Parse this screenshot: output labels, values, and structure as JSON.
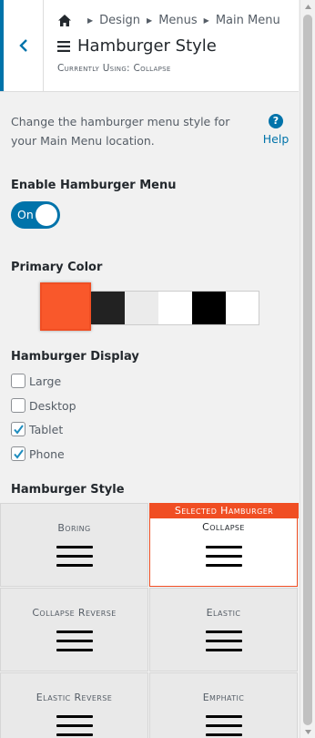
{
  "header": {
    "breadcrumbs": [
      "Design",
      "Menus",
      "Main Menu"
    ],
    "title": "Hamburger Style",
    "currently_using": "Currently Using: Collapse"
  },
  "description": "Change the hamburger menu style for your Main Menu location.",
  "help_label": "Help",
  "enable_label": "Enable Hamburger Menu",
  "toggle": {
    "state_text": "On"
  },
  "primary_color_label": "Primary Color",
  "swatches": [
    {
      "color": "#f9582b",
      "selected": true
    },
    {
      "color": "#222222"
    },
    {
      "color": "#ebebeb"
    },
    {
      "color": "#ffffff"
    },
    {
      "color": "#000000"
    },
    {
      "color": "#ffffff"
    }
  ],
  "display_label": "Hamburger Display",
  "display_options": [
    {
      "label": "Large",
      "checked": false
    },
    {
      "label": "Desktop",
      "checked": false
    },
    {
      "label": "Tablet",
      "checked": true
    },
    {
      "label": "Phone",
      "checked": true
    }
  ],
  "style_label": "Hamburger Style",
  "selected_banner": "Selected Hamburger",
  "styles": [
    {
      "name": "Boring"
    },
    {
      "name": "Collapse",
      "selected": true
    },
    {
      "name": "Collapse Reverse"
    },
    {
      "name": "Elastic"
    },
    {
      "name": "Elastic Reverse"
    },
    {
      "name": "Emphatic"
    }
  ],
  "colors": {
    "accent": "#0073aa",
    "selected": "#f04e23"
  }
}
